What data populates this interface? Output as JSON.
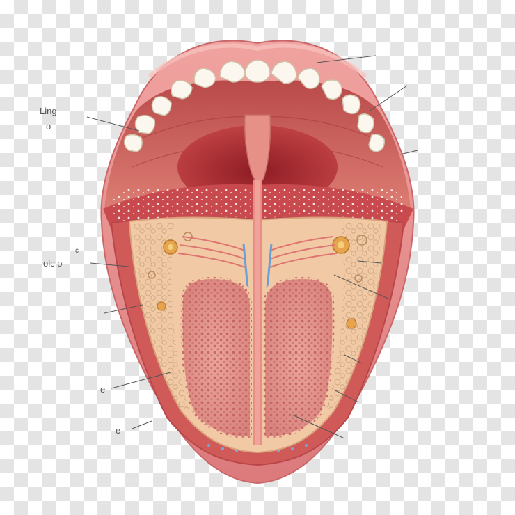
{
  "labels": {
    "top_left_1": "Ling",
    "top_left_2": "o",
    "mid_left": "olc o",
    "mid_left_small": "c",
    "low_left_1": "e",
    "low_left_2": "e"
  },
  "colors": {
    "lip": "#e68a8a",
    "lip_dark": "#c65a5e",
    "lip_highlight": "#f4b2ad",
    "teeth": "#fbf7ef",
    "palate": "#c95a58",
    "throat": "#a7282e",
    "tongue_surface": "#c64a4c",
    "muscle_lobe": "#e59a92",
    "muscle_dots": "#c96a66",
    "frame": "#f2c9a5",
    "cells": "#f7dfc0",
    "nerve_blue": "#6b9fd8",
    "label_line": "#555555"
  },
  "icons": {
    "main": "mouth-tongue-cross-section-illustration"
  }
}
